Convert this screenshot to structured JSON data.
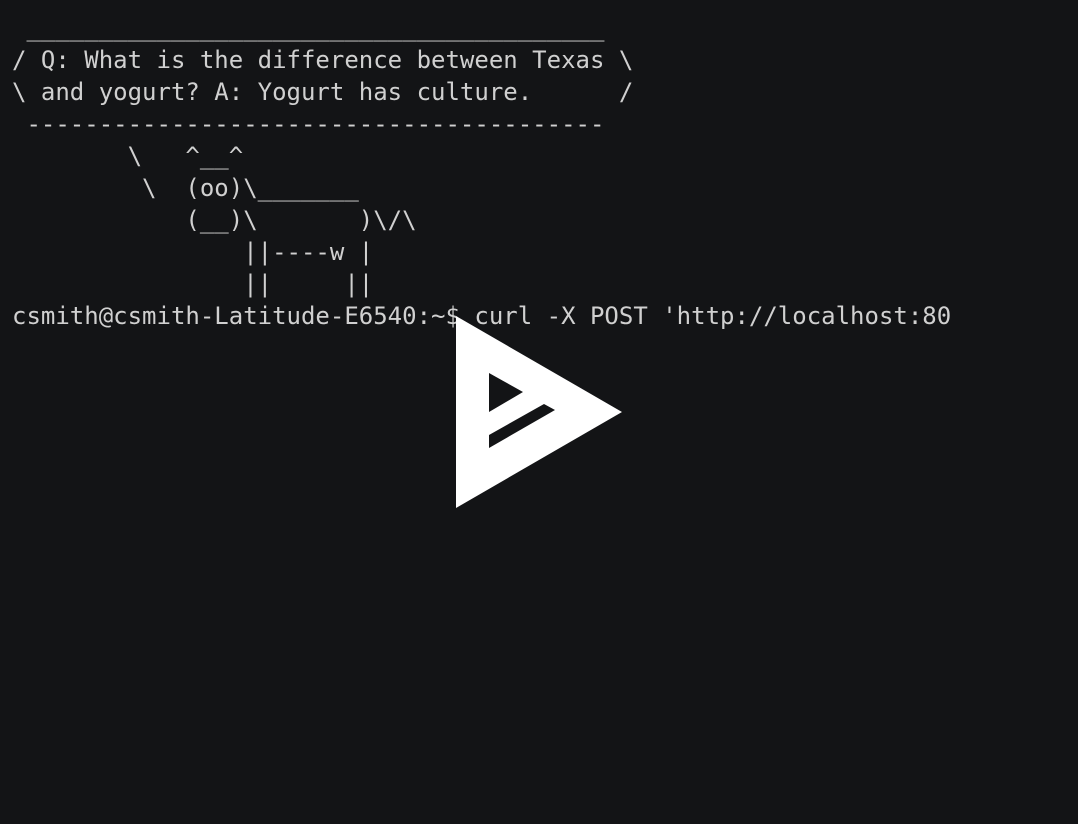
{
  "terminal": {
    "lines": [
      " ________________________________________",
      "/ Q: What is the difference between Texas \\",
      "\\ and yogurt? A: Yogurt has culture.      /",
      " ----------------------------------------",
      "        \\   ^__^",
      "         \\  (oo)\\_______",
      "            (__)\\       )\\/\\",
      "                ||----w |",
      "                ||     ||",
      "csmith@csmith-Latitude-E6540:~$ curl -X POST 'http://localhost:80"
    ]
  },
  "player": {
    "overlay_icon": "play-logo-icon"
  },
  "colors": {
    "background": "#131416",
    "text": "#d0d0d0",
    "icon": "#ffffff"
  }
}
